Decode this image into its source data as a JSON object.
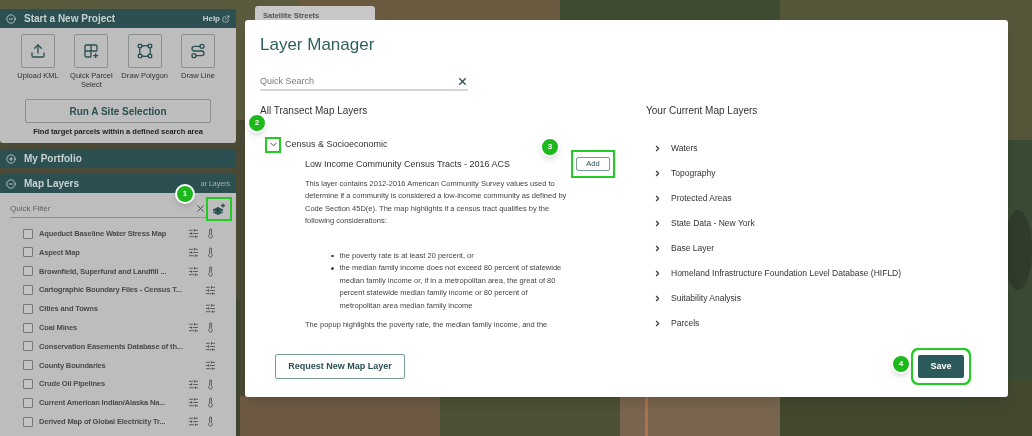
{
  "map_style_tab": {
    "label": "Satellite Streets"
  },
  "project_panel": {
    "title": "Start a New Project",
    "expanded": true,
    "help_label": "Help",
    "tools": [
      {
        "kind": "upload",
        "label": "Upload KML"
      },
      {
        "kind": "parcel",
        "label": "Quick Parcel Select"
      },
      {
        "kind": "polygon",
        "label": "Draw Polygon"
      },
      {
        "kind": "line",
        "label": "Draw Line"
      }
    ],
    "site_selection_button": "Run A Site Selection",
    "site_selection_caption": "Find target parcels within a defined search area"
  },
  "portfolio_panel": {
    "title": "My Portfolio",
    "expanded": false
  },
  "layers_panel": {
    "title": "Map Layers",
    "expanded": true,
    "clear_label": "ar Layers",
    "filter": {
      "placeholder": "Quick Filter"
    },
    "layers": [
      {
        "name": "Aqueduct Baseline Water Stress Map",
        "checked": false,
        "legend": true
      },
      {
        "name": "Aspect Map",
        "checked": false,
        "legend": true
      },
      {
        "name": "Brownfield, Superfund and Landfill ...",
        "checked": false,
        "legend": true
      },
      {
        "name": "Cartographic Boundary Files - Census T...",
        "checked": false,
        "legend": false
      },
      {
        "name": "Cities and Towns",
        "checked": false,
        "legend": false
      },
      {
        "name": "Coal Mines",
        "checked": false,
        "legend": true
      },
      {
        "name": "Conservation Easements Database of th...",
        "checked": false,
        "legend": false
      },
      {
        "name": "County Boundaries",
        "checked": false,
        "legend": false
      },
      {
        "name": "Crude Oil Pipelines",
        "checked": false,
        "legend": true
      },
      {
        "name": "Current American Indian/Alaska Na...",
        "checked": false,
        "legend": true
      },
      {
        "name": "Derived Map of Global Electricity Tr...",
        "checked": false,
        "legend": true
      }
    ]
  },
  "layer_manager": {
    "title": "Layer Manager",
    "search": {
      "placeholder": "Quick Search"
    },
    "all_layers_heading": "All Transect Map Layers",
    "category": {
      "name": "Census & Socioeconomic",
      "expanded": true,
      "layer": {
        "title": "Low Income Community Census Tracts - 2016 ACS",
        "add_label": "Add",
        "intro": "This layer contains 2012-2016 American Community Survey values used to determine if a community is considered a low-income community as defined by Code Section 45D(e). The map highlights if a census tract qualifies by the following considerations:",
        "bullets": [
          "the poverty rate is at least 20 percent, or",
          "the median family income does not exceed 80 percent of statewide median family income or, if in a metropolitan area, the great of 80 percent statewide median family income or 80 percent of metropolitan area median family income"
        ],
        "outro": "The popup highlights the poverty rate, the median family income, and the"
      }
    },
    "current_heading": "Your Current Map Layers",
    "current_layers": [
      {
        "name": "Waters",
        "expanded": false
      },
      {
        "name": "Topography",
        "expanded": false
      },
      {
        "name": "Protected Areas",
        "expanded": false
      },
      {
        "name": "State Data - New York",
        "expanded": false
      },
      {
        "name": "Base Layer",
        "expanded": false
      },
      {
        "name": "Homeland Infrastructure Foundation Level Database (HIFLD)",
        "expanded": false
      },
      {
        "name": "Suitability Analysis",
        "expanded": false
      },
      {
        "name": "Parcels",
        "expanded": false
      }
    ],
    "request_button": "Request New Map Layer",
    "save_button": "Save"
  },
  "annotations": [
    {
      "number": "1"
    },
    {
      "number": "2"
    },
    {
      "number": "3"
    },
    {
      "number": "4"
    }
  ]
}
